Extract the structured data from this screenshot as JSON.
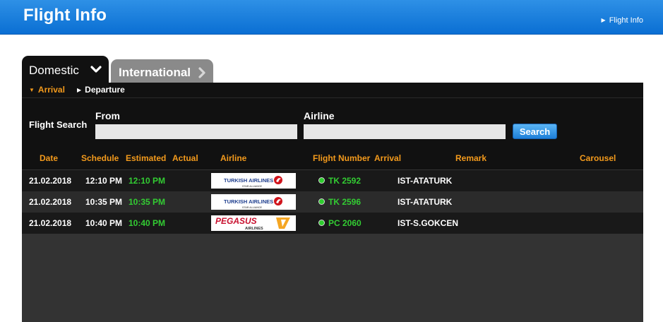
{
  "header": {
    "title": "Flight Info",
    "breadcrumb": "Flight Info"
  },
  "tabs": {
    "domestic": "Domestic",
    "international": "International"
  },
  "subnav": {
    "arrival": "Arrival",
    "departure": "Departure"
  },
  "search": {
    "label": "Flight Search",
    "from_label": "From",
    "from_value": "",
    "airline_label": "Airline",
    "airline_value": "",
    "button": "Search"
  },
  "table": {
    "columns": [
      "Date",
      "Schedule",
      "Estimated",
      "Actual",
      "Airline",
      "Flight Number",
      "Arrival",
      "Remark",
      "Carousel"
    ],
    "rows": [
      {
        "date": "21.02.2018",
        "schedule": "12:10 PM",
        "estimated": "12:10 PM",
        "actual": "",
        "airline_logo": "turkish-airlines-logo",
        "flight": "TK 2592",
        "arrival": "IST-ATATURK",
        "remark": "",
        "carousel": ""
      },
      {
        "date": "21.02.2018",
        "schedule": "10:35 PM",
        "estimated": "10:35 PM",
        "actual": "",
        "airline_logo": "turkish-airlines-logo",
        "flight": "TK 2596",
        "arrival": "IST-ATATURK",
        "remark": "",
        "carousel": ""
      },
      {
        "date": "21.02.2018",
        "schedule": "10:40 PM",
        "estimated": "10:40 PM",
        "actual": "",
        "airline_logo": "pegasus-airlines-logo",
        "flight": "PC 2060",
        "arrival": "IST-S.GOKCEN",
        "remark": "",
        "carousel": ""
      }
    ]
  },
  "logos": {
    "turkish": {
      "text": "TURKISH AIRLINES",
      "tagline": "STAR ALLIANCE",
      "color": "#1f3f8f",
      "accent": "#d0141c"
    },
    "pegasus": {
      "text": "PEGASUS",
      "sub": "AIRLINES",
      "color": "#c8102e",
      "accent": "#f5a623"
    }
  },
  "colors": {
    "accent_orange": "#f39a1c",
    "status_green": "#33cc33",
    "header_blue": "#0a6fd3"
  }
}
